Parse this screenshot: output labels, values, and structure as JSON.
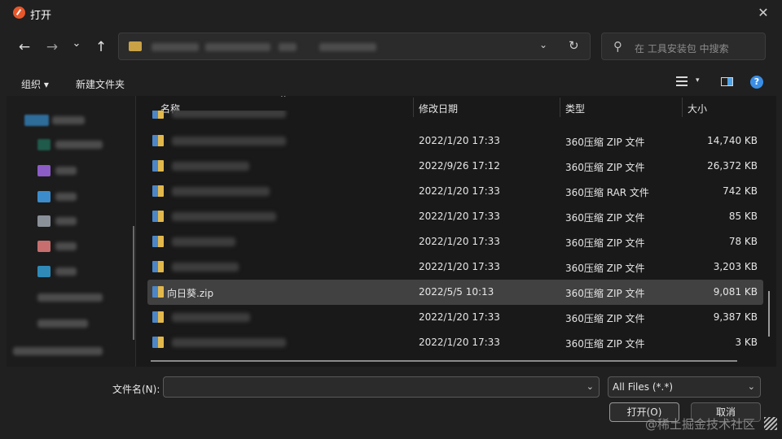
{
  "window": {
    "title": "打开",
    "close_glyph": "✕"
  },
  "nav": {
    "back_glyph": "←",
    "forward_glyph": "→",
    "recent_glyph": "⌄",
    "up_glyph": "↑",
    "address_chevron": "⌄",
    "refresh_glyph": "↻",
    "search_placeholder": "在 工具安装包 中搜索",
    "search_icon": "⚲"
  },
  "command_bar": {
    "organize_label": "组织 ▾",
    "new_folder_label": "新建文件夹",
    "view_caret": "▾",
    "help_glyph": "?"
  },
  "columns": {
    "name": "名称",
    "modified": "修改日期",
    "type": "类型",
    "size": "大小",
    "sort_glyph": "^"
  },
  "files": [
    {
      "name": "",
      "modified": "2022/1/20 17:33",
      "type": "360压缩 ZIP 文件",
      "size": "14,740 KB",
      "selected": false
    },
    {
      "name": "",
      "modified": "2022/9/26 17:12",
      "type": "360压缩 ZIP 文件",
      "size": "26,372 KB",
      "selected": false
    },
    {
      "name": "",
      "modified": "2022/1/20 17:33",
      "type": "360压缩 RAR 文件",
      "size": "742 KB",
      "selected": false
    },
    {
      "name": "",
      "modified": "2022/1/20 17:33",
      "type": "360压缩 ZIP 文件",
      "size": "85 KB",
      "selected": false
    },
    {
      "name": "",
      "modified": "2022/1/20 17:33",
      "type": "360压缩 ZIP 文件",
      "size": "78 KB",
      "selected": false
    },
    {
      "name": "",
      "modified": "2022/1/20 17:33",
      "type": "360压缩 ZIP 文件",
      "size": "3,203 KB",
      "selected": false
    },
    {
      "name": "向日葵.zip",
      "modified": "2022/5/5 10:13",
      "type": "360压缩 ZIP 文件",
      "size": "9,081 KB",
      "selected": true
    },
    {
      "name": "",
      "modified": "2022/1/20 17:33",
      "type": "360压缩 ZIP 文件",
      "size": "9,387 KB",
      "selected": false
    },
    {
      "name": "",
      "modified": "2022/1/20 17:33",
      "type": "360压缩 ZIP 文件",
      "size": "3 KB",
      "selected": false
    }
  ],
  "footer": {
    "filename_label": "文件名(N):",
    "filename_value": "",
    "filetype_value": "All Files (*.*)",
    "chevron": "⌄",
    "open_label": "打开(O)",
    "cancel_label": "取消",
    "watermark": "@稀土掘金技术社区"
  },
  "colors": {
    "accent": "#3a8ee6",
    "selected_row": "#414141",
    "background": "#202020"
  }
}
